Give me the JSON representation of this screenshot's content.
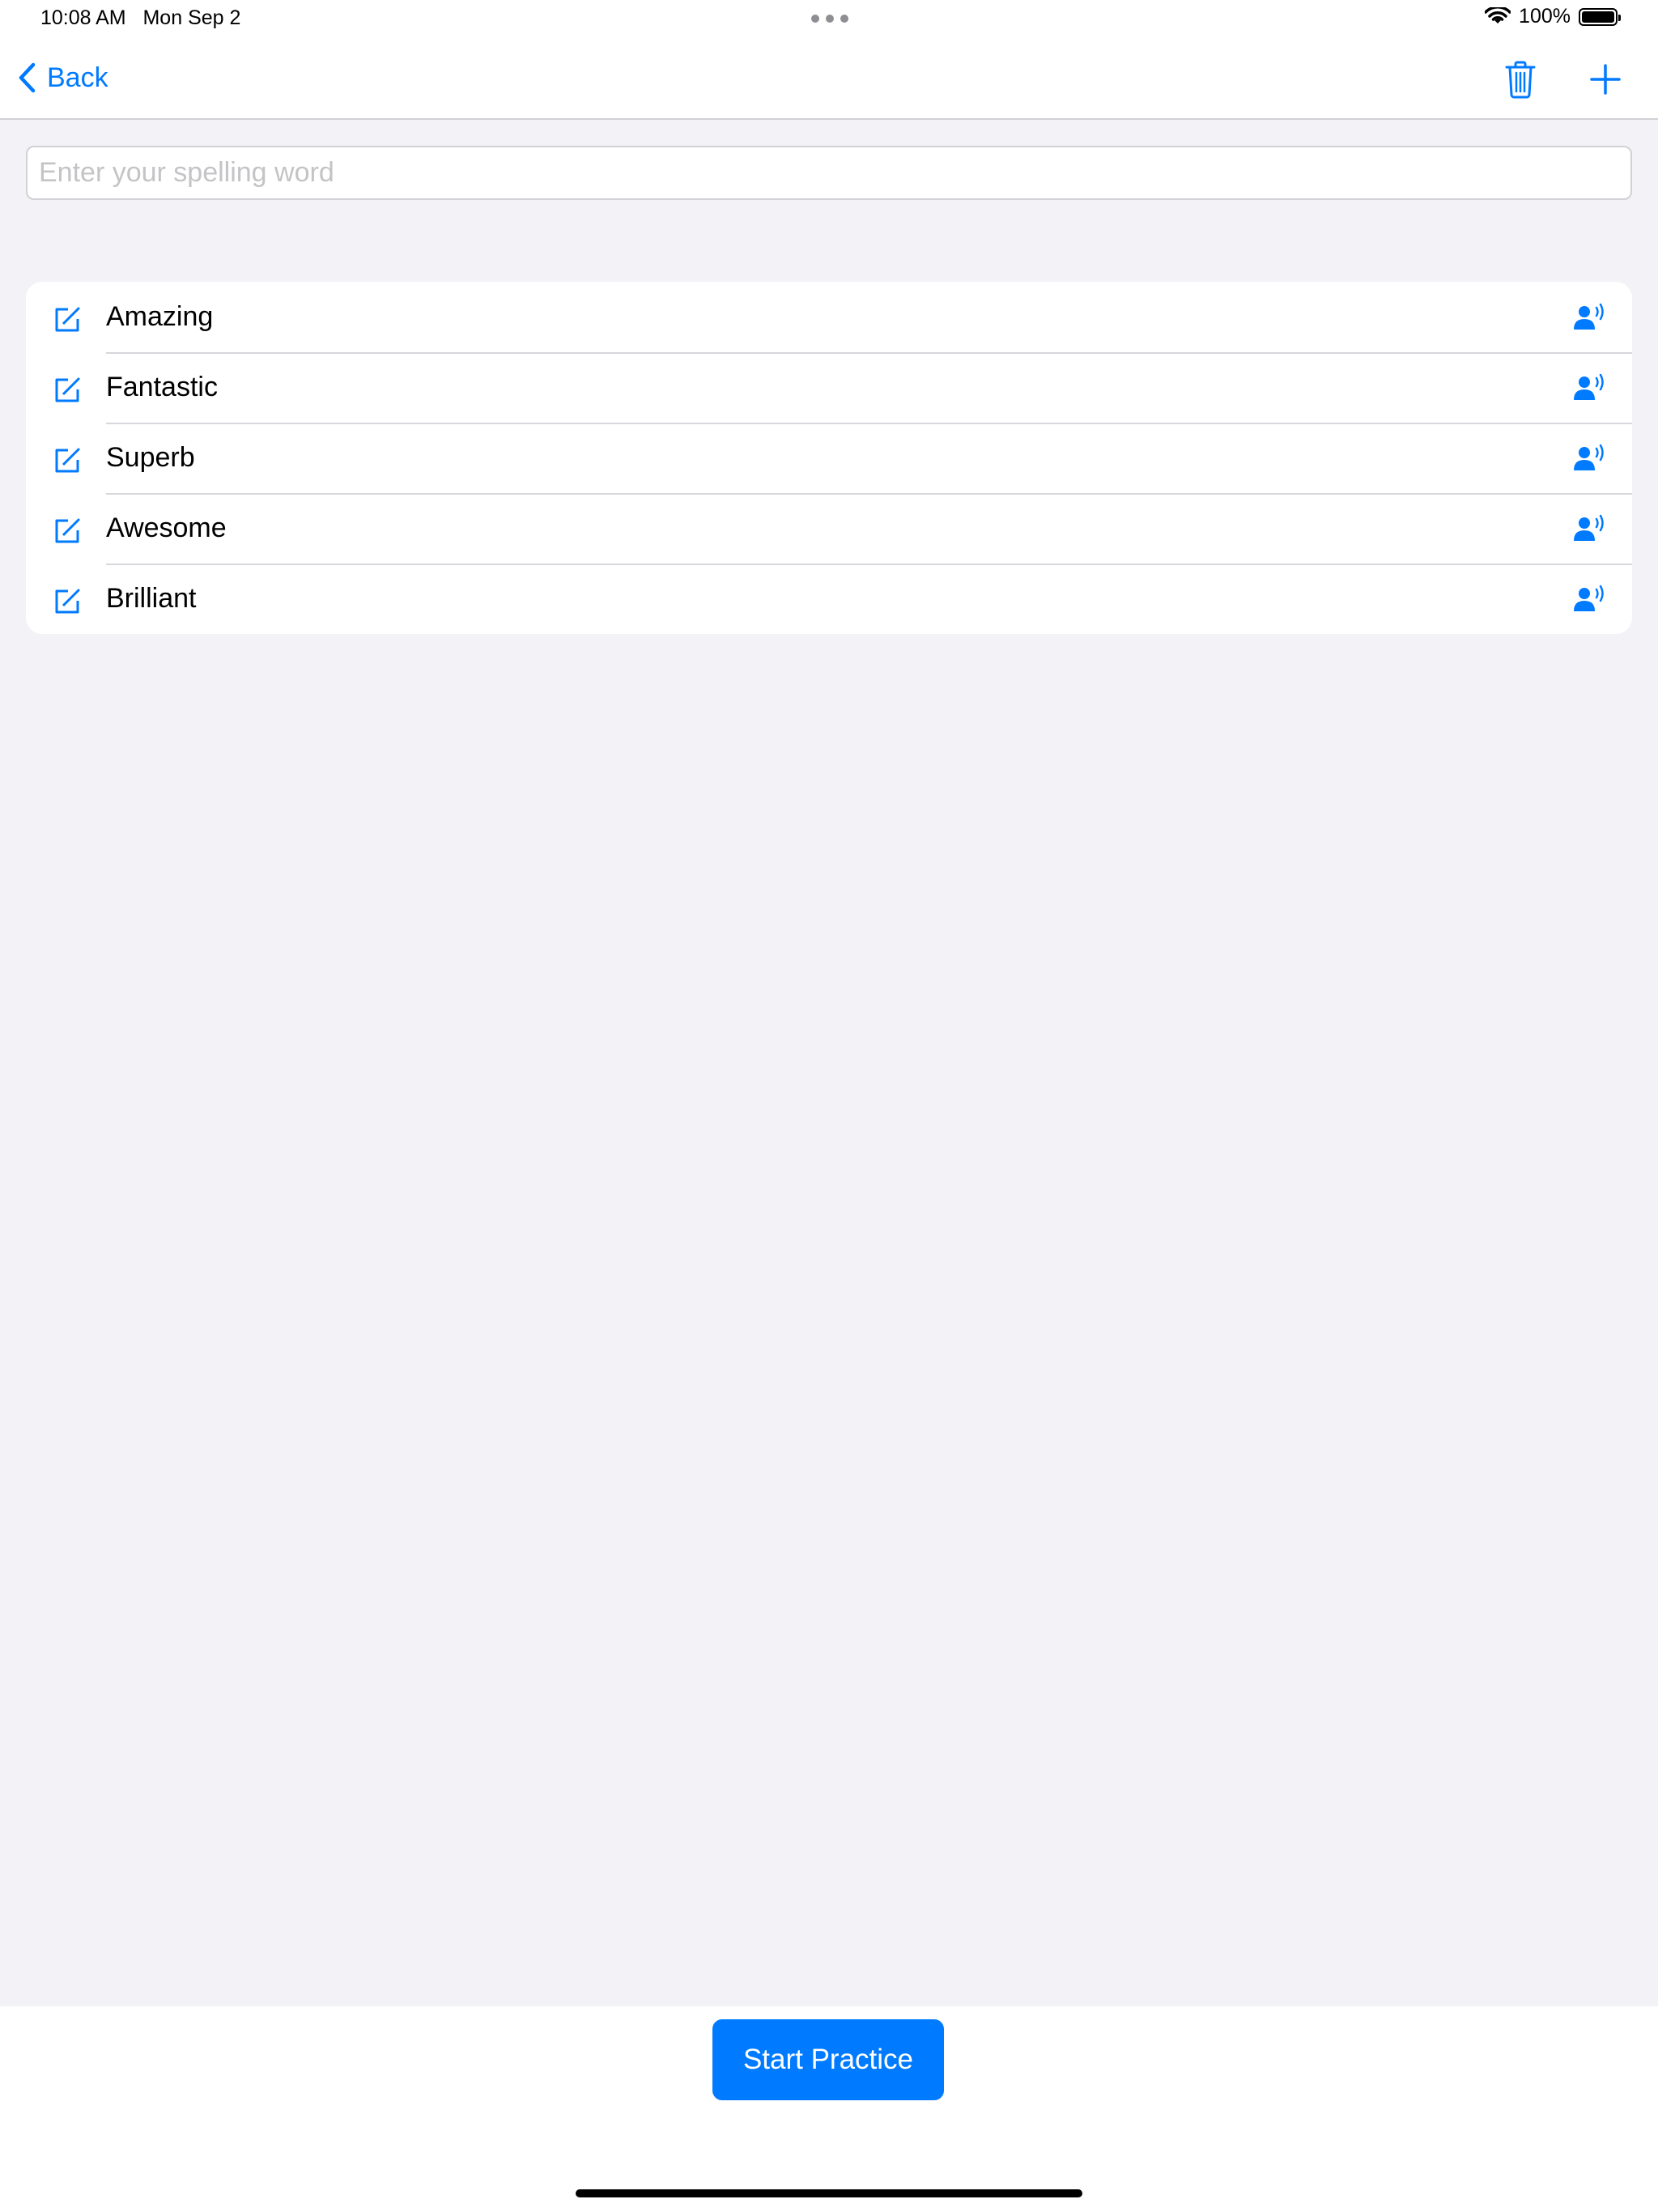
{
  "status_bar": {
    "time": "10:08 AM",
    "date": "Mon Sep 2",
    "battery": "100%"
  },
  "nav": {
    "back_label": "Back"
  },
  "search": {
    "placeholder": "Enter your spelling word"
  },
  "words": [
    {
      "label": "Amazing"
    },
    {
      "label": "Fantastic"
    },
    {
      "label": "Superb"
    },
    {
      "label": "Awesome"
    },
    {
      "label": "Brilliant"
    }
  ],
  "actions": {
    "start_label": "Start Practice"
  },
  "colors": {
    "accent": "#007aff",
    "background": "#f2f2f7"
  },
  "icons": [
    "chevron-left-icon",
    "trash-icon",
    "plus-icon",
    "edit-icon",
    "speaker-person-icon",
    "wifi-icon",
    "battery-icon"
  ]
}
